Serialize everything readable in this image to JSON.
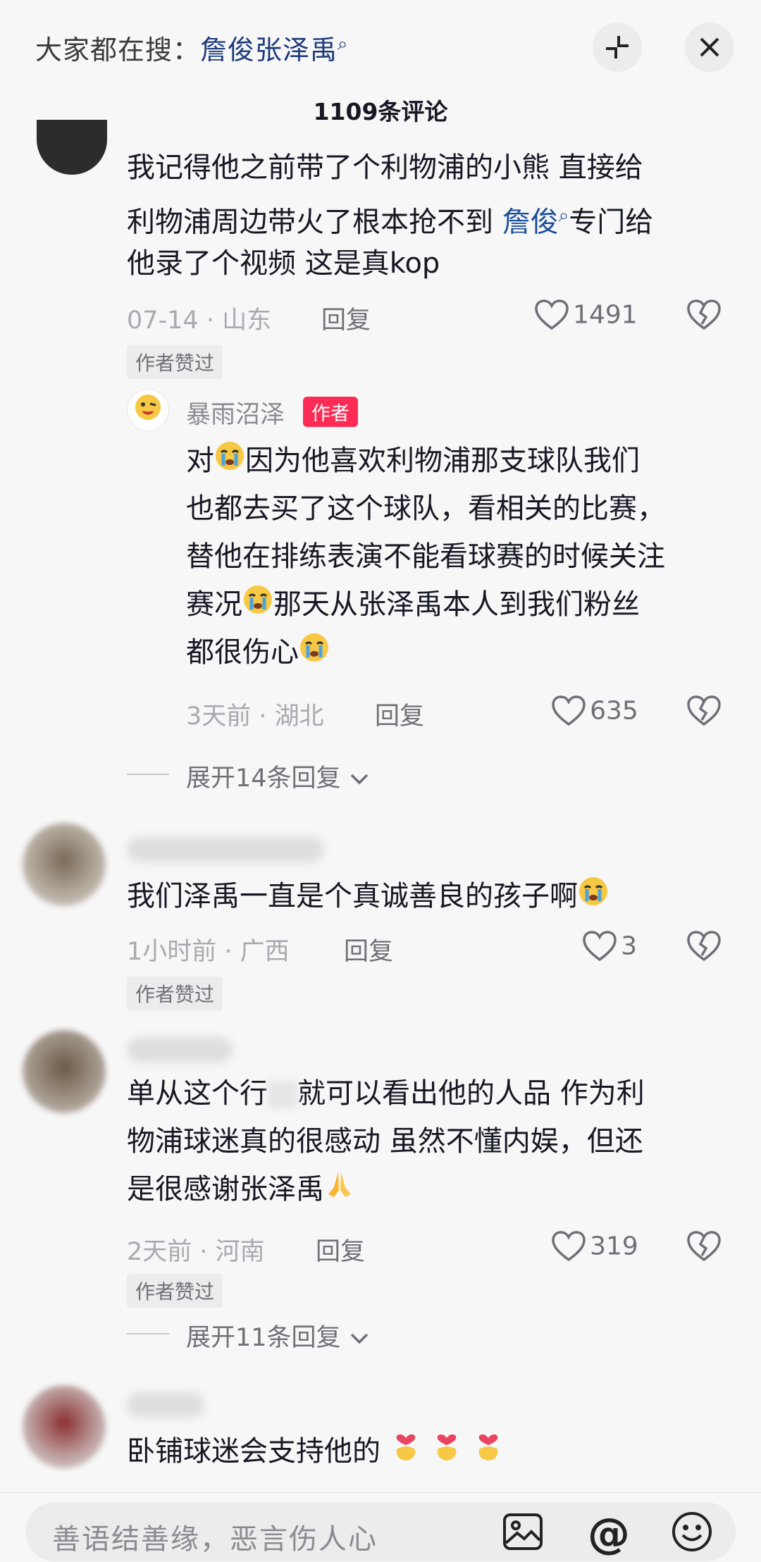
{
  "header": {
    "search_prefix": "大家都在搜：",
    "search_term": "詹俊张泽禹",
    "comment_count": "1109条评论"
  },
  "comments": [
    {
      "text_1": "我记得他之前带了个利物浦的小熊 直接给",
      "text_2a": "利物浦周边带火了根本抢不到 ",
      "text_2_link": "詹俊",
      "text_2b": "专门给",
      "text_3": "他录了个视频 这是真kop",
      "date": "07-14",
      "location": "山东",
      "reply_label": "回复",
      "likes": "1491",
      "badge": "作者赞过",
      "reply": {
        "username": "暴雨沼泽",
        "author_tag": "作者",
        "line_1a": "对",
        "line_1b": "因为他喜欢利物浦那支球队我们",
        "line_2": "也都去买了这个球队，看相关的比赛，",
        "line_3": "替他在排练表演不能看球赛的时候关注",
        "line_4a": "赛况",
        "line_4b": "那天从张泽禹本人到我们粉丝",
        "line_5": "都很伤心",
        "date": "3天前",
        "location": "湖北",
        "reply_label": "回复",
        "likes": "635"
      },
      "expand": "展开14条回复"
    },
    {
      "text_1": "我们泽禹一直是个真诚善良的孩子啊",
      "date": "1小时前",
      "location": "广西",
      "reply_label": "回复",
      "likes": "3",
      "badge": "作者赞过"
    },
    {
      "text_1a": "单从这个行",
      "text_1b": "就可以看出他的人品 作为利",
      "text_2": "物浦球迷真的很感动 虽然不懂内娱，但还",
      "text_3": "是很感谢张泽禹",
      "date": "2天前",
      "location": "河南",
      "reply_label": "回复",
      "likes": "319",
      "badge": "作者赞过",
      "expand": "展开11条回复"
    },
    {
      "text_1": "卧铺球迷会支持他的"
    }
  ],
  "input": {
    "placeholder": "善语结善缘，恶言伤人心"
  },
  "colors": {
    "accent_red": "#fe2c55",
    "link_blue": "#1d4f9a"
  }
}
